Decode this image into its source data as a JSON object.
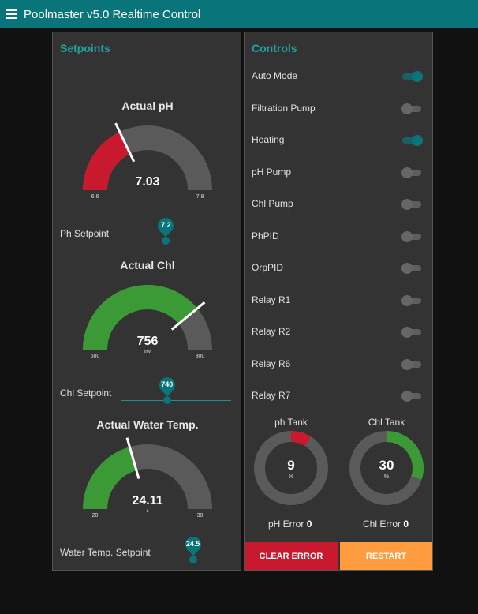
{
  "app": {
    "title": "Poolmaster v5.0 Realtime Control"
  },
  "setpoints": {
    "title": "Setpoints",
    "ph_gauge": {
      "title": "Actual pH",
      "value": "7.03",
      "unit": "",
      "min": "6.6",
      "max": "7.8",
      "min_num": 6.6,
      "max_num": 7.8,
      "val_num": 7.03,
      "color": "#c8192e"
    },
    "ph_setpoint": {
      "label": "Ph Setpoint",
      "value": "7.2",
      "fraction": 0.41
    },
    "chl_gauge": {
      "title": "Actual Chl",
      "value": "756",
      "unit": "mV",
      "min": "600",
      "max": "800",
      "min_num": 600,
      "max_num": 800,
      "val_num": 756,
      "color": "#3c9a36"
    },
    "chl_setpoint": {
      "label": "Chl Setpoint",
      "value": "740",
      "fraction": 0.42
    },
    "temp_gauge": {
      "title": "Actual Water Temp.",
      "value": "24.11",
      "unit": "c",
      "min": "20",
      "max": "30",
      "min_num": 20,
      "max_num": 30,
      "val_num": 24.11,
      "color": "#3c9a36"
    },
    "temp_setpoint": {
      "label": "Water Temp. Setpoint",
      "value": "24.5",
      "fraction": 0.45
    }
  },
  "controls": {
    "title": "Controls",
    "switches": [
      {
        "label": "Auto Mode",
        "on": true
      },
      {
        "label": "Filtration Pump",
        "on": false
      },
      {
        "label": "Heating",
        "on": true
      },
      {
        "label": "pH Pump",
        "on": false
      },
      {
        "label": "Chl Pump",
        "on": false
      },
      {
        "label": "PhPID",
        "on": false
      },
      {
        "label": "OrpPID",
        "on": false
      },
      {
        "label": "Relay R1",
        "on": false
      },
      {
        "label": "Relay R2",
        "on": false
      },
      {
        "label": "Relay R6",
        "on": false
      },
      {
        "label": "Relay R7",
        "on": false
      }
    ],
    "ph_tank": {
      "title": "ph Tank",
      "value": "9",
      "unit": "%",
      "percent": 9,
      "color": "#c8192e"
    },
    "chl_tank": {
      "title": "Chl Tank",
      "value": "30",
      "unit": "%",
      "percent": 30,
      "color": "#3c9a36"
    },
    "ph_error": {
      "label": "pH Error",
      "value": "0"
    },
    "chl_error": {
      "label": "Chl Error",
      "value": "0"
    },
    "clear_error_label": "CLEAR ERROR",
    "restart_label": "RESTART"
  },
  "colors": {
    "header": "#097479",
    "accent": "#1fa3a3",
    "danger": "#c8192e",
    "warning": "#ff9c40",
    "gauge_track": "#5a5a5a"
  }
}
